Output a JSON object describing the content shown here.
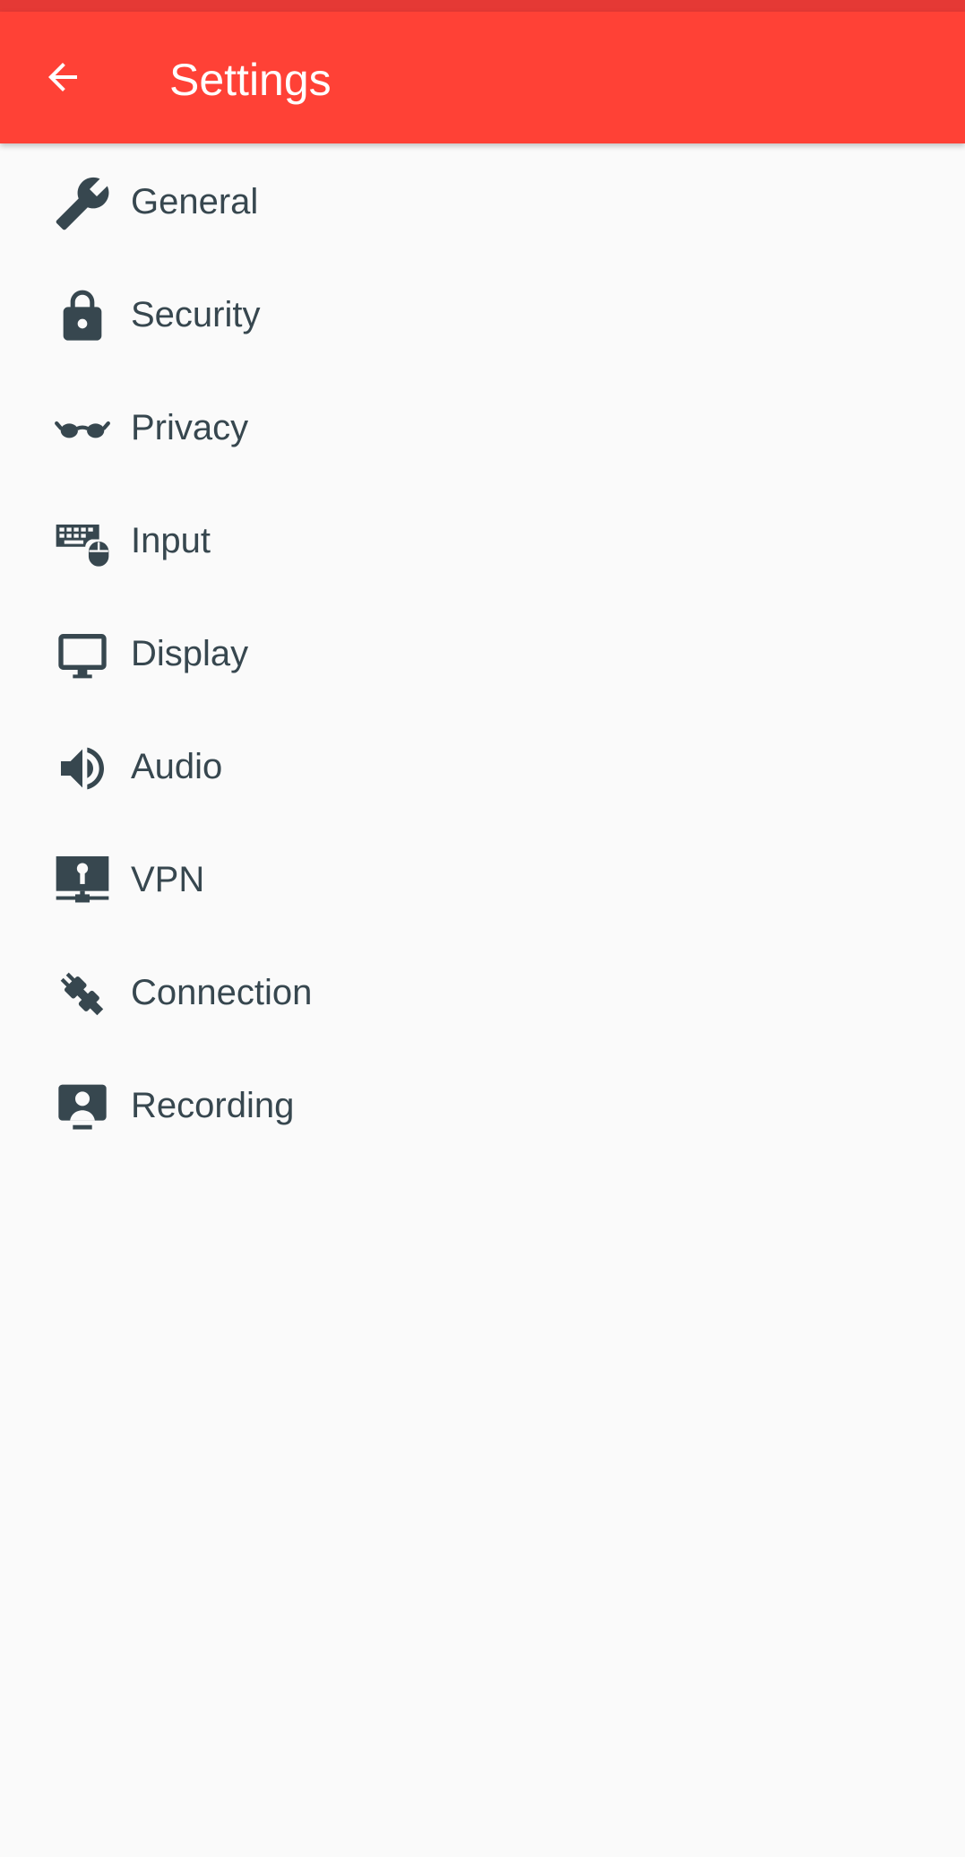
{
  "colors": {
    "status_bar": "#e53935",
    "app_bar": "#ff4136",
    "app_bar_text": "#ffffff",
    "background": "#fafafa",
    "icon": "#37474f",
    "label": "#37474f"
  },
  "header": {
    "back_icon": "arrow-left-icon",
    "title": "Settings"
  },
  "menu": {
    "items": [
      {
        "label": "General",
        "icon": "wrench-icon"
      },
      {
        "label": "Security",
        "icon": "lock-icon"
      },
      {
        "label": "Privacy",
        "icon": "glasses-icon"
      },
      {
        "label": "Input",
        "icon": "keyboard-mouse-icon"
      },
      {
        "label": "Display",
        "icon": "monitor-icon"
      },
      {
        "label": "Audio",
        "icon": "speaker-icon"
      },
      {
        "label": "VPN",
        "icon": "vpn-monitor-icon"
      },
      {
        "label": "Connection",
        "icon": "plug-icon"
      },
      {
        "label": "Recording",
        "icon": "screen-recording-icon"
      }
    ]
  }
}
